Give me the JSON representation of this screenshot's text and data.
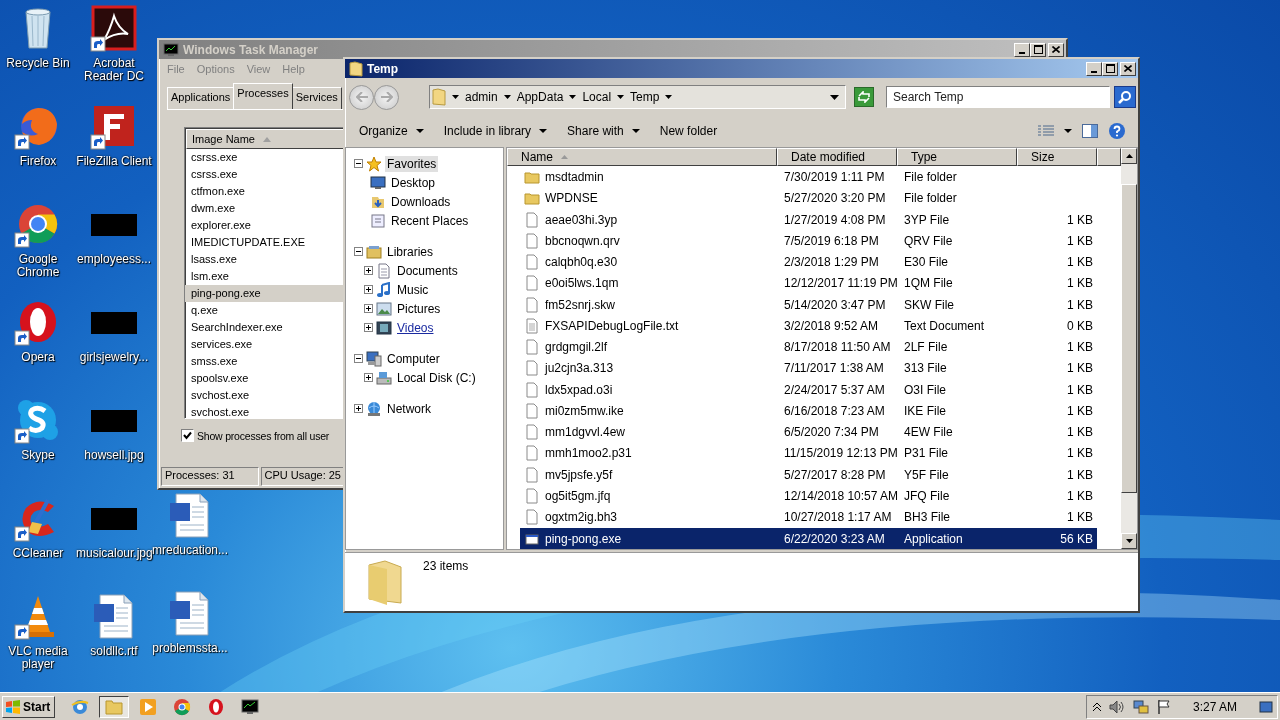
{
  "desktop_columns": [
    [
      {
        "label": "Recycle Bin",
        "kind": "trash",
        "shortcut": false
      },
      {
        "label": "Firefox",
        "kind": "fox",
        "shortcut": true
      },
      {
        "label": "Google Chrome",
        "kind": "chrome",
        "shortcut": true
      },
      {
        "label": "Opera",
        "kind": "opera",
        "shortcut": true
      },
      {
        "label": "Skype",
        "kind": "cloud",
        "shortcut": true
      },
      {
        "label": "CCleaner",
        "kind": "cleaner",
        "shortcut": true
      },
      {
        "label": "VLC media player",
        "kind": "cone",
        "shortcut": true
      }
    ],
    [
      {
        "label": "Acrobat Reader DC",
        "kind": "pdf",
        "shortcut": true
      },
      {
        "label": "FileZilla Client",
        "kind": "ftp",
        "shortcut": true
      },
      {
        "label": "employeess...",
        "kind": "thumbnail",
        "shortcut": false
      },
      {
        "label": "girlsjewelry...",
        "kind": "thumbnail",
        "shortcut": false
      },
      {
        "label": "howsell.jpg",
        "kind": "thumbnail",
        "shortcut": false
      },
      {
        "label": "musicalour.jpg",
        "kind": "thumbnail",
        "shortcut": false
      },
      {
        "label": "soldllc.rtf",
        "kind": "document",
        "shortcut": false
      }
    ],
    [
      {
        "label": "mreducation...",
        "kind": "document",
        "shortcut": false
      },
      {
        "label": "problemssta...",
        "kind": "document",
        "shortcut": false
      }
    ]
  ],
  "task_manager": {
    "title": "Windows Task Manager",
    "active": false,
    "menu": [
      "File",
      "Options",
      "View",
      "Help"
    ],
    "tabs": [
      {
        "label": "Applications",
        "selected": false
      },
      {
        "label": "Processes",
        "selected": true
      },
      {
        "label": "Services",
        "selected": false
      }
    ],
    "column": "Image Name",
    "processes": [
      {
        "name": "csrss.exe",
        "selected": false
      },
      {
        "name": "csrss.exe",
        "selected": false
      },
      {
        "name": "ctfmon.exe",
        "selected": false
      },
      {
        "name": "dwm.exe",
        "selected": false
      },
      {
        "name": "explorer.exe",
        "selected": false
      },
      {
        "name": "IMEDICTUPDATE.EXE",
        "selected": false
      },
      {
        "name": "lsass.exe",
        "selected": false
      },
      {
        "name": "lsm.exe",
        "selected": false
      },
      {
        "name": "ping-pong.exe",
        "selected": true
      },
      {
        "name": "q.exe",
        "selected": false
      },
      {
        "name": "SearchIndexer.exe",
        "selected": false
      },
      {
        "name": "services.exe",
        "selected": false
      },
      {
        "name": "smss.exe",
        "selected": false
      },
      {
        "name": "spoolsv.exe",
        "selected": false
      },
      {
        "name": "svchost.exe",
        "selected": false
      },
      {
        "name": "svchost.exe",
        "selected": false
      }
    ],
    "show_all_users": {
      "label": "Show processes from all user",
      "checked": true
    },
    "status": [
      "Processes: 31",
      "CPU Usage: 25"
    ]
  },
  "explorer": {
    "title": "Temp",
    "active": true,
    "breadcrumb": [
      "admin",
      "AppData",
      "Local",
      "Temp"
    ],
    "search": {
      "placeholder": "Search Temp"
    },
    "toolbar": [
      {
        "label": "Organize",
        "menu": true
      },
      {
        "label": "Include in library",
        "menu": true
      },
      {
        "label": "Share with",
        "menu": true
      },
      {
        "label": "New folder",
        "menu": false
      }
    ],
    "tree": [
      {
        "label": "Favorites",
        "kind": "star",
        "expanded": true,
        "selected": true,
        "hot": false,
        "children": [
          {
            "label": "Desktop",
            "kind": "desktop",
            "selected": false,
            "hot": false
          },
          {
            "label": "Downloads",
            "kind": "downloads",
            "selected": false,
            "hot": false
          },
          {
            "label": "Recent Places",
            "kind": "recent",
            "selected": false,
            "hot": false
          }
        ]
      },
      {
        "label": "Libraries",
        "kind": "library",
        "expanded": true,
        "selected": false,
        "hot": false,
        "children": [
          {
            "label": "Documents",
            "kind": "documents",
            "expanded": false,
            "selected": false,
            "hot": false
          },
          {
            "label": "Music",
            "kind": "music",
            "expanded": false,
            "selected": false,
            "hot": false
          },
          {
            "label": "Pictures",
            "kind": "pictures",
            "expanded": false,
            "selected": false,
            "hot": false
          },
          {
            "label": "Videos",
            "kind": "videos",
            "expanded": false,
            "selected": false,
            "hot": true
          }
        ]
      },
      {
        "label": "Computer",
        "kind": "computer",
        "expanded": true,
        "selected": false,
        "hot": false,
        "children": [
          {
            "label": "Local Disk (C:)",
            "kind": "disk",
            "expanded": false,
            "selected": false,
            "hot": false
          }
        ]
      },
      {
        "label": "Network",
        "kind": "network",
        "expanded": false,
        "selected": false,
        "hot": false
      }
    ],
    "columns": [
      {
        "label": "Name",
        "sorted": true
      },
      {
        "label": "Date modified",
        "sorted": false
      },
      {
        "label": "Type",
        "sorted": false
      },
      {
        "label": "Size",
        "sorted": false
      }
    ],
    "files": [
      {
        "name": "msdtadmin",
        "date": "7/30/2019 1:11 PM",
        "type": "File folder",
        "kind": "folder",
        "selected": false
      },
      {
        "name": "WPDNSE",
        "date": "5/27/2020 3:20 PM",
        "type": "File folder",
        "kind": "folder",
        "selected": false
      },
      {
        "name": "aeae03hi.3yp",
        "date": "1/27/2019 4:08 PM",
        "type": "3YP File",
        "size": "1 KB",
        "kind": "file",
        "selected": false
      },
      {
        "name": "bbcnoqwn.qrv",
        "date": "7/5/2019 6:18 PM",
        "type": "QRV File",
        "size": "1 KB",
        "kind": "file",
        "selected": false
      },
      {
        "name": "calqbh0q.e30",
        "date": "2/3/2018 1:29 PM",
        "type": "E30 File",
        "size": "1 KB",
        "kind": "file",
        "selected": false
      },
      {
        "name": "e0oi5lws.1qm",
        "date": "12/12/2017 11:19 PM",
        "type": "1QM File",
        "size": "1 KB",
        "kind": "file",
        "selected": false
      },
      {
        "name": "fm52snrj.skw",
        "date": "5/14/2020 3:47 PM",
        "type": "SKW File",
        "size": "1 KB",
        "kind": "file",
        "selected": false
      },
      {
        "name": "FXSAPIDebugLogFile.txt",
        "date": "3/2/2018 9:52 AM",
        "type": "Text Document",
        "size": "0 KB",
        "kind": "text",
        "selected": false
      },
      {
        "name": "grdgmgil.2lf",
        "date": "8/17/2018 11:50 AM",
        "type": "2LF File",
        "size": "1 KB",
        "kind": "file",
        "selected": false
      },
      {
        "name": "ju2cjn3a.313",
        "date": "7/11/2017 1:38 AM",
        "type": "313 File",
        "size": "1 KB",
        "kind": "file",
        "selected": false
      },
      {
        "name": "ldx5xpad.o3i",
        "date": "2/24/2017 5:37 AM",
        "type": "O3I File",
        "size": "1 KB",
        "kind": "file",
        "selected": false
      },
      {
        "name": "mi0zm5mw.ike",
        "date": "6/16/2018 7:23 AM",
        "type": "IKE File",
        "size": "1 KB",
        "kind": "file",
        "selected": false
      },
      {
        "name": "mm1dgvvl.4ew",
        "date": "6/5/2020 7:34 PM",
        "type": "4EW File",
        "size": "1 KB",
        "kind": "file",
        "selected": false
      },
      {
        "name": "mmh1moo2.p31",
        "date": "11/15/2019 12:13 PM",
        "type": "P31 File",
        "size": "1 KB",
        "kind": "file",
        "selected": false
      },
      {
        "name": "mv5jpsfe.y5f",
        "date": "5/27/2017 8:28 PM",
        "type": "Y5F File",
        "size": "1 KB",
        "kind": "file",
        "selected": false
      },
      {
        "name": "og5it5gm.jfq",
        "date": "12/14/2018 10:57 AM",
        "type": "JFQ File",
        "size": "1 KB",
        "kind": "file",
        "selected": false
      },
      {
        "name": "ogxtm2ig.bh3",
        "date": "10/27/2018 1:17 AM",
        "type": "BH3 File",
        "size": "1 KB",
        "kind": "file",
        "selected": false
      },
      {
        "name": "ping-pong.exe",
        "date": "6/22/2020 3:23 AM",
        "type": "Application",
        "size": "56 KB",
        "kind": "app",
        "selected": true
      }
    ],
    "status": "23 items"
  },
  "taskbar": {
    "start": "Start",
    "apps": [
      {
        "kind": "ie",
        "active": false
      },
      {
        "kind": "folder",
        "active": true
      },
      {
        "kind": "media",
        "active": false
      },
      {
        "kind": "chrome",
        "active": false
      },
      {
        "kind": "opera",
        "active": false
      },
      {
        "kind": "taskmgr",
        "active": false
      }
    ],
    "clock": "3:27 AM"
  }
}
